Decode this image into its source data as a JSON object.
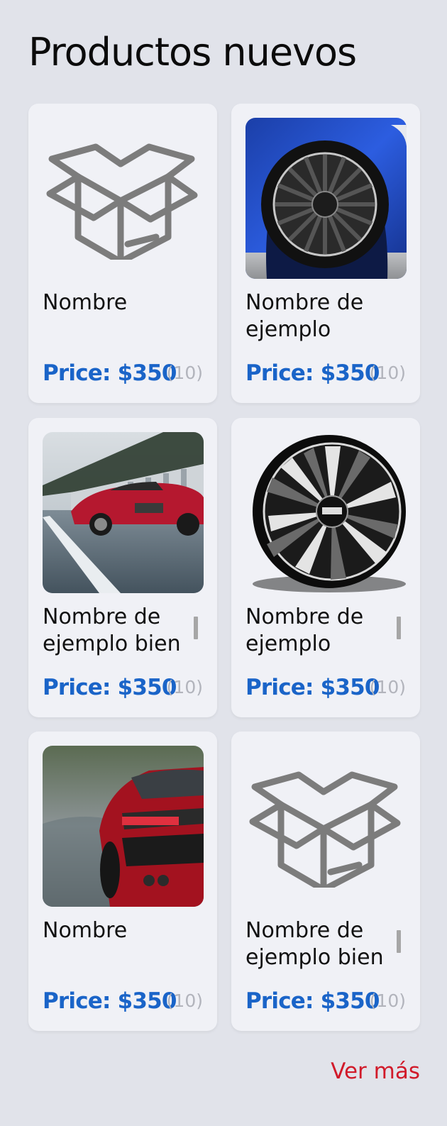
{
  "section": {
    "title": "Productos nuevos",
    "more_label": "Ver más"
  },
  "colors": {
    "background": "#e1e3ea",
    "card": "#f0f1f6",
    "price": "#1a64c8",
    "count": "#b2b4bc",
    "link": "#d11a2a",
    "placeholder_icon": "#7c7c7c"
  },
  "products": [
    {
      "name": "Nombre",
      "price": "Price: $350",
      "count": "(10)",
      "image": "box-placeholder-icon",
      "has_scrollbar": false
    },
    {
      "name": "Nombre de ejemplo",
      "price": "Price: $350",
      "count": "(10)",
      "image": "car-wheel-photo",
      "has_scrollbar": false
    },
    {
      "name": "Nombre de ejemplo bien",
      "price": "Price: $350",
      "count": "(10)",
      "image": "red-sports-car-side-photo",
      "has_scrollbar": true
    },
    {
      "name": "Nombre de ejemplo",
      "price": "Price: $350",
      "count": "(10)",
      "image": "alloy-rim-photo",
      "has_scrollbar": true
    },
    {
      "name": "Nombre",
      "price": "Price: $350",
      "count": "(10)",
      "image": "red-sports-car-rear-photo",
      "has_scrollbar": false
    },
    {
      "name": "Nombre de ejemplo bien",
      "price": "Price: $350",
      "count": "(10)",
      "image": "box-placeholder-icon",
      "has_scrollbar": true
    }
  ]
}
